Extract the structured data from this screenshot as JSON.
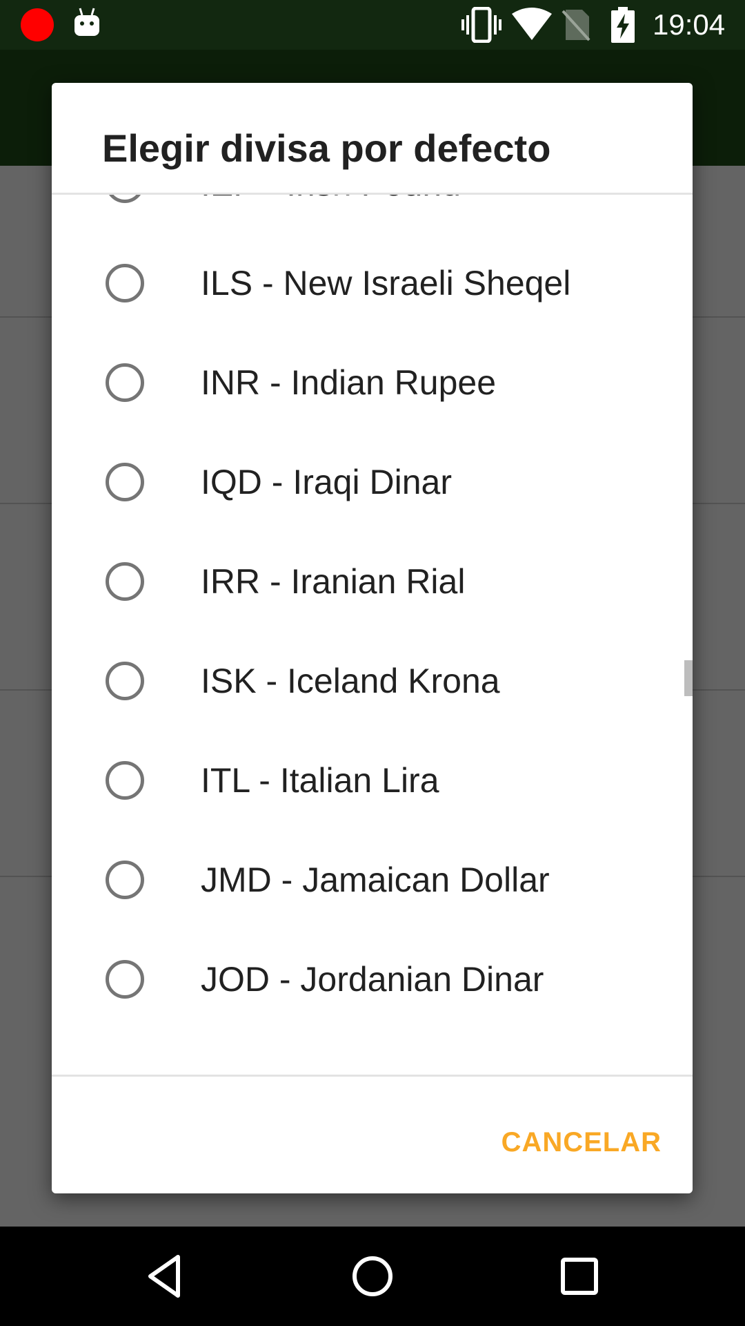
{
  "status_bar": {
    "time": "19:04",
    "icons": [
      "record-dot-icon",
      "android-debug-icon",
      "vibrate-icon",
      "wifi-icon",
      "no-sim-icon",
      "battery-charging-icon"
    ]
  },
  "dialog": {
    "title": "Elegir divisa por defecto",
    "items": [
      {
        "label": "IEP - Irish Pound"
      },
      {
        "label": "ILS - New Israeli Sheqel"
      },
      {
        "label": "INR - Indian Rupee"
      },
      {
        "label": "IQD - Iraqi Dinar"
      },
      {
        "label": "IRR - Iranian Rial"
      },
      {
        "label": "ISK - Iceland Krona"
      },
      {
        "label": "ITL - Italian Lira"
      },
      {
        "label": "JMD - Jamaican Dollar"
      },
      {
        "label": "JOD - Jordanian Dinar"
      },
      {
        "label": ""
      }
    ],
    "cancel_label": "CANCELAR"
  },
  "colors": {
    "status_bar": "#122810",
    "app_bar": "#1f4d17",
    "accent": "#f9a825",
    "radio": "#757575"
  },
  "nav_bar": {
    "icons": [
      "back-icon",
      "home-icon",
      "recents-icon"
    ]
  }
}
